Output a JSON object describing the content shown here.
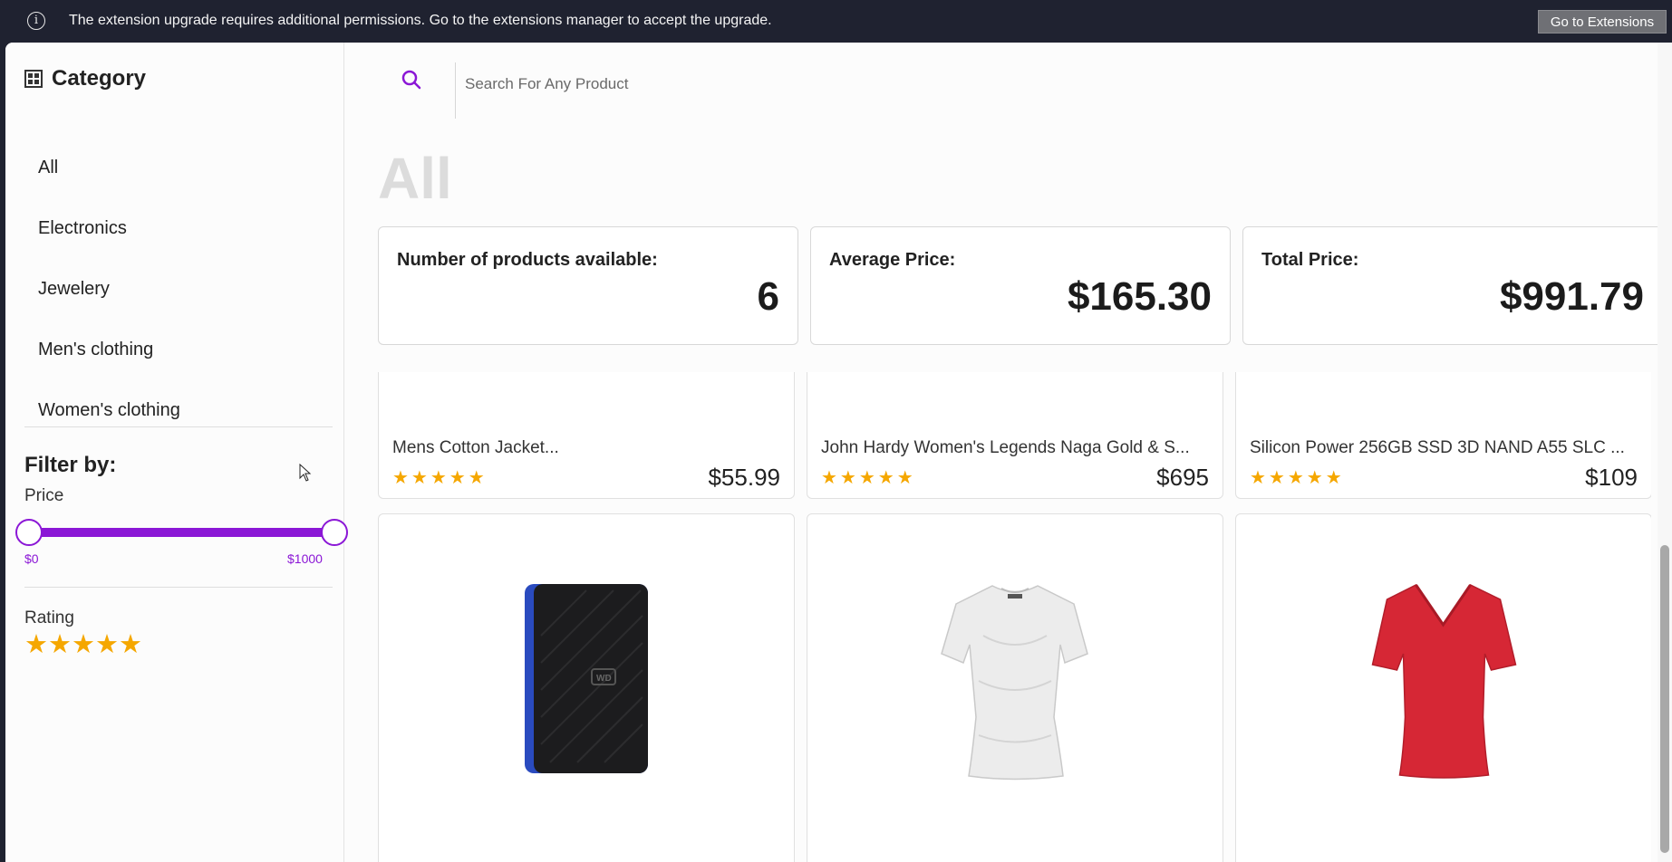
{
  "notice": {
    "text": "The extension upgrade requires additional permissions. Go to the extensions manager to accept the upgrade.",
    "button": "Go to Extensions",
    "icon": "info-icon"
  },
  "sidebar": {
    "title": "Category",
    "categories": [
      "All",
      "Electronics",
      "Jewelery",
      "Men's clothing",
      "Women's clothing"
    ],
    "filter_title": "Filter by:",
    "price_label": "Price",
    "price_min": "$0",
    "price_max": "$1000",
    "price_range_fraction": [
      0,
      1
    ],
    "rating_label": "Rating",
    "rating_value": 5,
    "rating_stars": "★★★★★"
  },
  "search": {
    "placeholder": "Search For Any Product"
  },
  "main": {
    "title": "All",
    "stats": [
      {
        "label": "Number of products available:",
        "value": "6"
      },
      {
        "label": "Average Price:",
        "value": "$165.30"
      },
      {
        "label": "Total Price:",
        "value": "$991.79"
      }
    ]
  },
  "products": [
    {
      "title": "Mens Cotton Jacket...",
      "stars": "★★★★★",
      "price": "$55.99"
    },
    {
      "title": "John Hardy Women's Legends Naga Gold & S...",
      "stars": "★★★★★",
      "price": "$695"
    },
    {
      "title": "Silicon Power 256GB SSD 3D NAND A55 SLC ...",
      "stars": "★★★★★",
      "price": "$109"
    },
    {
      "image": "external-hard-drive"
    },
    {
      "image": "white-tshirt"
    },
    {
      "image": "red-tshirt"
    }
  ],
  "colors": {
    "accent": "#8b17d6",
    "star": "#f5a700",
    "notice_bg": "#1f2230"
  }
}
